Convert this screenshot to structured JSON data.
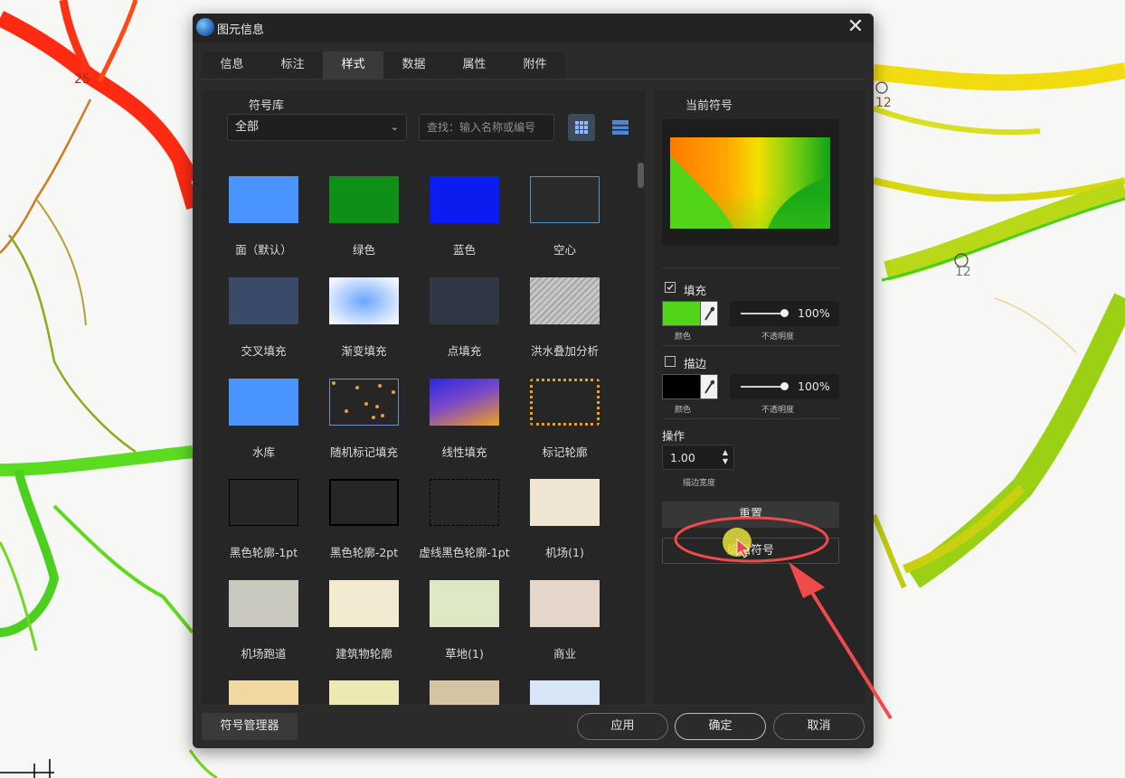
{
  "map": {
    "labels": [
      "25",
      "12",
      "12"
    ]
  },
  "dialog": {
    "title": "图元信息",
    "close_glyph": "✕",
    "tabs": [
      {
        "label": "信息",
        "active": false
      },
      {
        "label": "标注",
        "active": false
      },
      {
        "label": "样式",
        "active": true
      },
      {
        "label": "数据",
        "active": false
      },
      {
        "label": "属性",
        "active": false
      },
      {
        "label": "附件",
        "active": false
      }
    ]
  },
  "library": {
    "label": "符号库",
    "category": "全部",
    "chevron": "⌄",
    "search_placeholder": "查找：输入名称或编号",
    "symbols": [
      {
        "label": "面（默认）",
        "style": "fill",
        "color": "#4a94ff"
      },
      {
        "label": "绿色",
        "style": "fill",
        "color": "#0e8f16"
      },
      {
        "label": "蓝色",
        "style": "fill",
        "color": "#0a1cf0"
      },
      {
        "label": "空心",
        "style": "outline",
        "color": "#5b8fc8"
      },
      {
        "label": "交叉填充",
        "style": "fill",
        "color": "#3a4a68"
      },
      {
        "label": "渐变填充",
        "style": "radial",
        "color": "#6aa6ff"
      },
      {
        "label": "点填充",
        "style": "fill",
        "color": "#2f3644"
      },
      {
        "label": "洪水叠加分析",
        "style": "hatch",
        "color": "#b9b9b9"
      },
      {
        "label": "水库",
        "style": "fill",
        "color": "#4a94ff"
      },
      {
        "label": "随机标记填充",
        "style": "dots",
        "color": "#e8a030"
      },
      {
        "label": "线性填充",
        "style": "linear",
        "color": "#3a3ad8"
      },
      {
        "label": "标记轮廓",
        "style": "dotted-outline",
        "color": "#f0a020"
      },
      {
        "label": "黑色轮廓-1pt",
        "style": "black-outline-1",
        "color": "#000000"
      },
      {
        "label": "黑色轮廓-2pt",
        "style": "black-outline-2",
        "color": "#000000"
      },
      {
        "label": "虚线黑色轮廓-1pt",
        "style": "dashed-outline",
        "color": "#000000"
      },
      {
        "label": "机场(1)",
        "style": "fill",
        "color": "#eee6d2"
      },
      {
        "label": "机场跑道",
        "style": "fill",
        "color": "#c9c9c0"
      },
      {
        "label": "建筑物轮廓",
        "style": "fill",
        "color": "#f3ead2"
      },
      {
        "label": "草地(1)",
        "style": "fill",
        "color": "#dfe8c4"
      },
      {
        "label": "商业",
        "style": "fill",
        "color": "#e4d6c8"
      },
      {
        "label": "",
        "style": "fill",
        "color": "#f0d8a0"
      },
      {
        "label": "",
        "style": "fill",
        "color": "#eee8b4"
      },
      {
        "label": "",
        "style": "fill",
        "color": "#d4c4a4"
      },
      {
        "label": "",
        "style": "fill",
        "color": "#d6e6f6"
      }
    ]
  },
  "current": {
    "label": "当前符号",
    "fill": {
      "label": "填充",
      "checked": true,
      "color": "#52d418",
      "color_caption": "颜色",
      "opacity": "100%",
      "opacity_caption": "不透明度"
    },
    "stroke": {
      "label": "描边",
      "checked": false,
      "color": "#000000",
      "color_caption": "颜色",
      "opacity": "100%",
      "opacity_caption": "不透明度"
    },
    "ops_label": "操作",
    "stroke_width": "1.00",
    "stroke_width_caption": "描边宽度",
    "reset_label": "重置",
    "edit_label": "编辑符号"
  },
  "footer": {
    "symbol_manager": "符号管理器",
    "apply": "应用",
    "ok": "确定",
    "cancel": "取消"
  },
  "colors": {
    "highlight": "#f04a4a",
    "cursor_glow": "#e6e23a"
  }
}
